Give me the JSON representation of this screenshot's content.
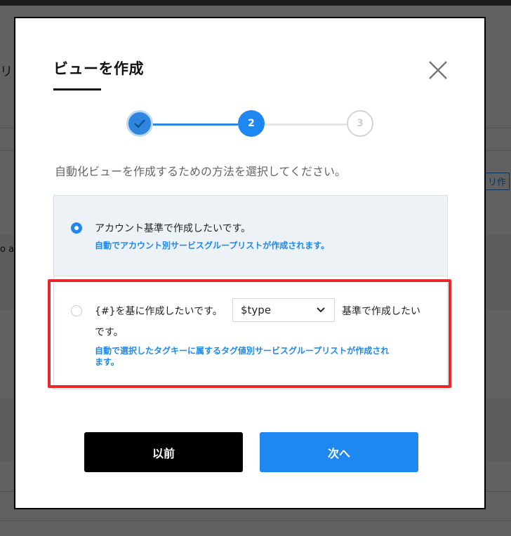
{
  "background": {
    "snippet_a": "リ",
    "snippet_b": "o a",
    "snippet_c": "リ作"
  },
  "modal": {
    "title": "ビューを作成",
    "close_icon": "close-icon",
    "instruction": "自動化ビューを作成するための方法を選択してください。",
    "steps": [
      {
        "label": "",
        "state": "complete",
        "icon": "check-icon"
      },
      {
        "label": "2",
        "state": "current"
      },
      {
        "label": "3",
        "state": "pending"
      }
    ],
    "options": [
      {
        "label": "アカウント基準で作成したいです。",
        "description": "自動でアカウント別サービスグループリストが作成されます。",
        "selected": true
      },
      {
        "label_prefix": "{#}を基に作成したいです。",
        "select_value": "$type",
        "label_suffix": "基準で作成したい",
        "label_wrap": "です。",
        "description_line1": "自動で選択したタグキーに属するタグ値別サービスグループリストが作成され",
        "description_line2": "ます。",
        "selected": false
      }
    ],
    "buttons": {
      "prev": "以前",
      "next": "次へ"
    }
  },
  "colors": {
    "accent": "#1e88f0",
    "highlight": "#e8262b",
    "prev_button": "#000000"
  }
}
